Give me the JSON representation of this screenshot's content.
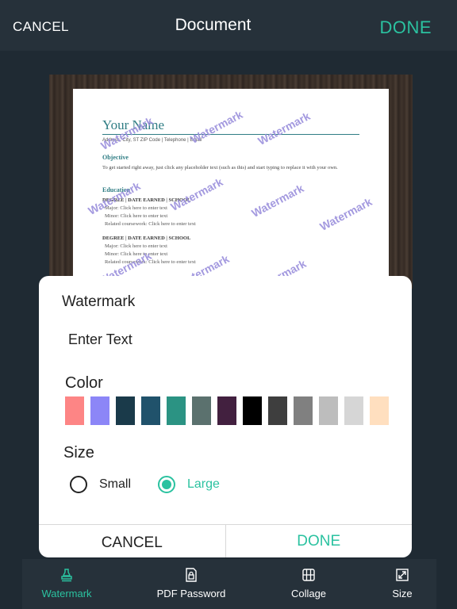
{
  "header": {
    "cancel": "CANCEL",
    "title": "Document",
    "done": "DONE"
  },
  "document": {
    "name": "Your Name",
    "contact": "Address, City, ST ZIP Code | Telephone | Email",
    "objective_heading": "Objective",
    "objective_text": "To get started right away, just click any placeholder text (such as this) and start typing to replace it with your own.",
    "education_heading": "Education",
    "degree1": "DEGREE | DATE EARNED | SCHOOL",
    "degree2": "DEGREE | DATE EARNED | SCHOOL",
    "items": [
      "Major: Click here to enter text",
      "Minor: Click here to enter text",
      "Related coursework: Click here to enter text"
    ],
    "watermark": "Watermark"
  },
  "dialog": {
    "title": "Watermark",
    "text_value": "Enter Text",
    "color_label": "Color",
    "colors": [
      "#fd8585",
      "#8c86f7",
      "#1a3a4a",
      "#20526b",
      "#2b9383",
      "#5b716e",
      "#42203f",
      "#000000",
      "#3e3e3e",
      "#808080",
      "#bdbdbd",
      "#d6d6d6",
      "#ffdfbf"
    ],
    "size_label": "Size",
    "size_options": [
      {
        "label": "Small",
        "selected": false
      },
      {
        "label": "Large",
        "selected": true
      }
    ],
    "cancel": "CANCEL",
    "done": "DONE",
    "accent": "#2bc2a0"
  },
  "tabs": [
    {
      "label": "Watermark",
      "icon": "stamp-icon",
      "active": true
    },
    {
      "label": "PDF Password",
      "icon": "lock-document-icon",
      "active": false
    },
    {
      "label": "Collage",
      "icon": "collage-grid-icon",
      "active": false
    },
    {
      "label": "Size",
      "icon": "resize-icon",
      "active": false
    }
  ]
}
